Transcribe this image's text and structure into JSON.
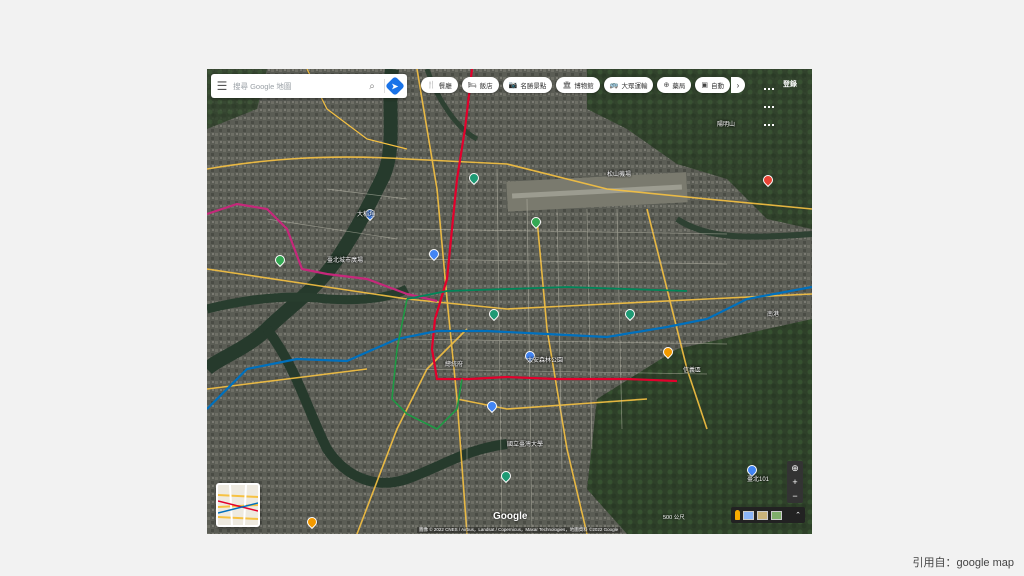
{
  "map": {
    "search": {
      "placeholder": "搜尋 Google 地圖"
    },
    "chips": [
      {
        "icon": "fork-knife-icon",
        "glyph": "🍴",
        "label": "餐廳"
      },
      {
        "icon": "bed-icon",
        "glyph": "🛏",
        "label": "飯店"
      },
      {
        "icon": "camera-icon",
        "glyph": "📷",
        "label": "名勝景點"
      },
      {
        "icon": "museum-icon",
        "glyph": "🏛",
        "label": "博物館"
      },
      {
        "icon": "bus-icon",
        "glyph": "🚌",
        "label": "大眾運輸"
      },
      {
        "icon": "pharmacy-icon",
        "glyph": "⊕",
        "label": "藥局"
      },
      {
        "icon": "atm-icon",
        "glyph": "▣",
        "label": "自動"
      }
    ],
    "login_label": "登錄",
    "google_logo": "Google",
    "attribution": "圖像 © 2022 CNES / Airbus，Landsat / Copernicus，Maxar Technologies，地圖資料 ©2022 Google",
    "scale_label": "500 公尺",
    "places": [
      "臺北城市廣場",
      "總統府",
      "臺北101",
      "松山機場",
      "大安森林公園",
      "國立臺灣大學",
      "陽明山",
      "信義區",
      "大稻埕",
      "南港"
    ],
    "colors": {
      "mrt_red": "#e3002c",
      "mrt_blue": "#0070bd",
      "mrt_green": "#008659",
      "mrt_purple": "#c5287a",
      "road_yellow": "#f7c242"
    }
  },
  "footer": {
    "citation": "引用自：google map"
  }
}
